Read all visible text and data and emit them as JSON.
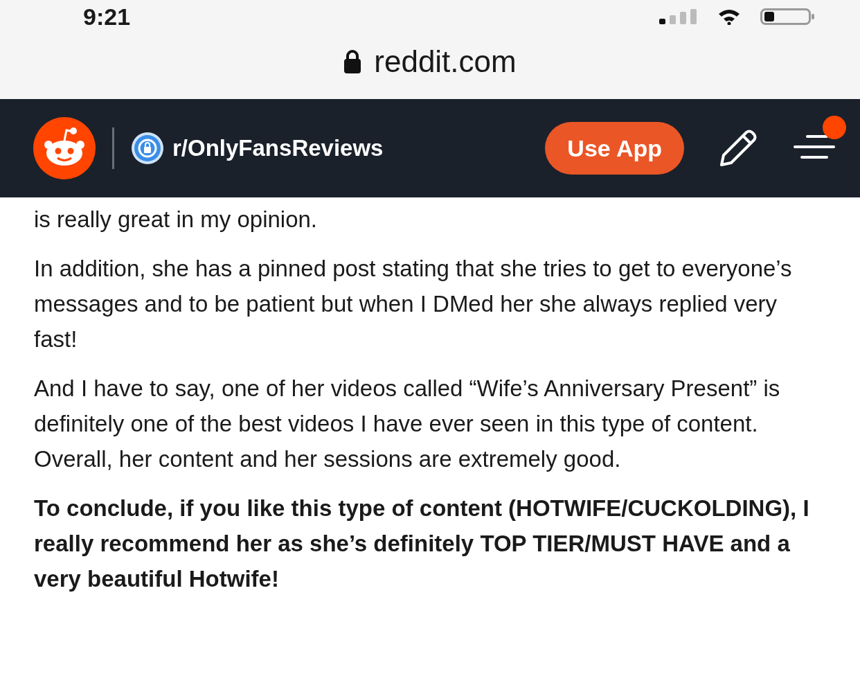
{
  "status_bar": {
    "time": "9:21"
  },
  "address_bar": {
    "url": "reddit.com"
  },
  "header": {
    "subreddit": "r/OnlyFansReviews",
    "use_app_button": "Use App",
    "menu_notification": true
  },
  "post": {
    "paragraphs": [
      {
        "kind": "normal",
        "text": "is really great in my opinion."
      },
      {
        "kind": "normal",
        "text": "In addition, she has a pinned post stating that she tries to get to everyone’s messages and to be patient but when I DMed her she always replied very fast!"
      },
      {
        "kind": "normal",
        "text": "And I have to say, one of her videos called “Wife’s Anniversary Present” is definitely one of the best videos I have ever seen in this type of content. Overall, her content and her sessions are extremely good."
      },
      {
        "kind": "bold",
        "text": "To conclude, if you like this type of content (HOTWIFE/CUCKOLDING), I really recommend her as she’s definitely TOP TIER/MUST HAVE and a very beautiful Hotwife!"
      }
    ]
  }
}
